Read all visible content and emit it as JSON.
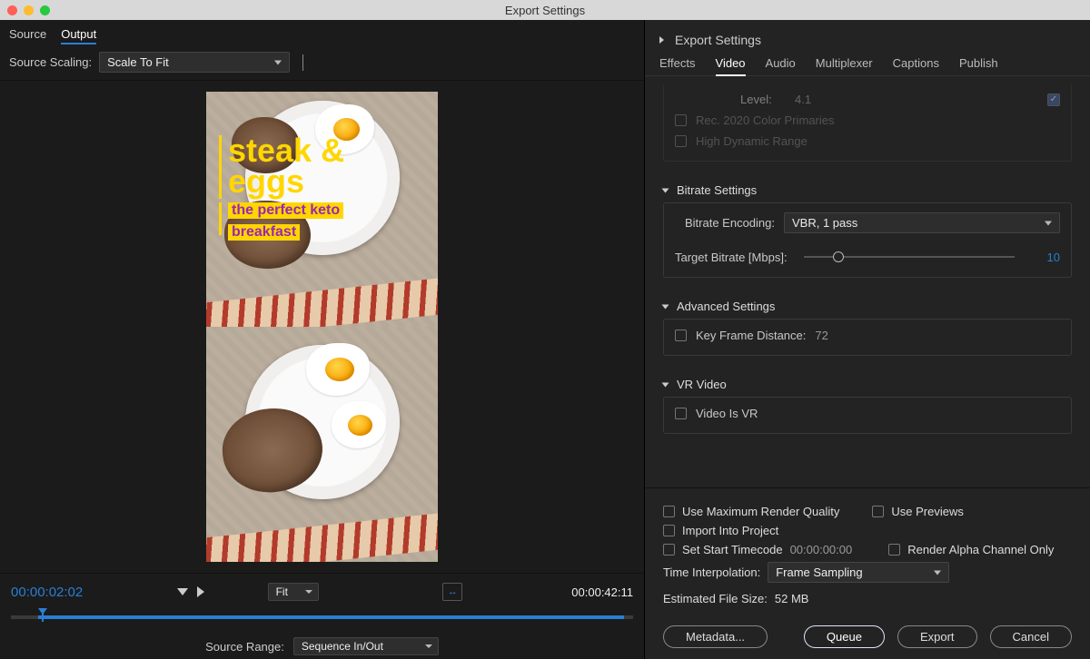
{
  "window": {
    "title": "Export Settings"
  },
  "left": {
    "tabs": {
      "source": "Source",
      "output": "Output"
    },
    "source_scaling_label": "Source Scaling:",
    "source_scaling_value": "Scale To Fit",
    "overlay": {
      "line1": "steak &",
      "line2": "eggs",
      "sub1": "the perfect keto",
      "sub2": "breakfast"
    },
    "time_current": "00:00:02:02",
    "fit_label": "Fit",
    "time_total": "00:00:42:11",
    "source_range_label": "Source Range:",
    "source_range_value": "Sequence In/Out"
  },
  "right": {
    "header": "Export Settings",
    "tabs": {
      "effects": "Effects",
      "video": "Video",
      "audio": "Audio",
      "multiplexer": "Multiplexer",
      "captions": "Captions",
      "publish": "Publish"
    },
    "level_label": "Level:",
    "level_value": "4.1",
    "rec2020": "Rec. 2020 Color Primaries",
    "hdr": "High Dynamic Range",
    "bitrate_section": "Bitrate Settings",
    "bitrate_encoding_label": "Bitrate Encoding:",
    "bitrate_encoding_value": "VBR, 1 pass",
    "target_bitrate_label": "Target Bitrate [Mbps]:",
    "target_bitrate_value": "10",
    "advanced_section": "Advanced Settings",
    "keyframe_label": "Key Frame Distance:",
    "keyframe_value": "72",
    "vr_section": "VR Video",
    "vr_label": "Video Is VR",
    "use_max": "Use Maximum Render Quality",
    "use_previews": "Use Previews",
    "import_proj": "Import Into Project",
    "set_start": "Set Start Timecode",
    "set_start_val": "00:00:00:00",
    "render_alpha": "Render Alpha Channel Only",
    "time_interp_label": "Time Interpolation:",
    "time_interp_value": "Frame Sampling",
    "est_label": "Estimated File Size:",
    "est_value": "52 MB",
    "metadata_btn": "Metadata...",
    "queue_btn": "Queue",
    "export_btn": "Export",
    "cancel_btn": "Cancel"
  }
}
